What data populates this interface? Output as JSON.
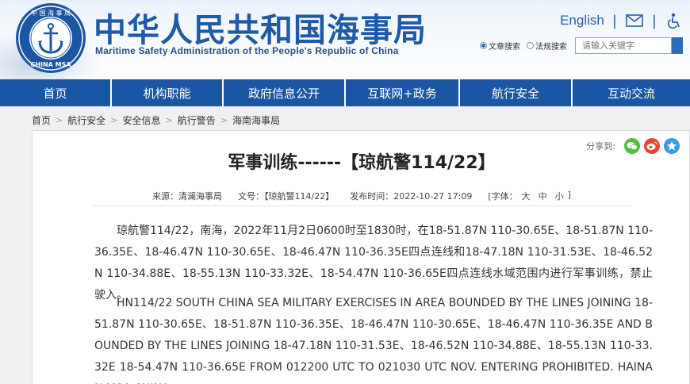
{
  "header": {
    "logo": {
      "top_text": "中 国 海 事 局",
      "bottom_text": "CHINA MSA"
    },
    "title": "中华人民共和国海事局",
    "subtitle": "Maritime Safety Administration of the People's Republic of China",
    "english_link": "English",
    "separator": "|",
    "search": {
      "option1": "文章搜索",
      "option2": "法规搜索",
      "placeholder": "请输入关键字"
    }
  },
  "nav": {
    "items": [
      {
        "label": "首页"
      },
      {
        "label": "机构职能"
      },
      {
        "label": "政府信息公开"
      },
      {
        "label": "互联网+政务"
      },
      {
        "label": "航行安全"
      },
      {
        "label": "互动交流"
      }
    ]
  },
  "breadcrumb": {
    "items": [
      "首页",
      "航行安全",
      "安全信息",
      "航行警告",
      "海南海事局"
    ],
    "separator": ">"
  },
  "article": {
    "share_label": "分享到:",
    "title": "军事训练------【琼航警114/22】",
    "meta": {
      "source": "来源：清澜海事局",
      "doc_no": "文号：【琼航警114/22】",
      "published": "发布时间：2022-10-27 17:09",
      "font_label": "[字体：",
      "font_large": "大",
      "font_medium": "中",
      "font_small": "小",
      "font_close": "]"
    },
    "paragraph_cn": "琼航警114/22，南海，2022年11月2日0600时至1830时，在18-51.87N 110-30.65E、18-51.87N 110-36.35E、18-46.47N 110-30.65E、18-46.47N 110-36.35E四点连线和18-47.18N 110-31.53E、18-46.52N 110-34.88E、18-55.13N 110-33.32E、18-54.47N 110-36.65E四点连线水域范围内进行军事训练，禁止驶入。",
    "paragraph_en": "HN114/22 SOUTH CHINA SEA MILITARY EXERCISES IN AREA BOUNDED BY THE LINES JOINING 18-51.87N 110-30.65E、18-51.87N 110-36.35E、18-46.47N 110-30.65E、18-46.47N 110-36.35E AND BOUNDED BY THE LINES JOINING 18-47.18N 110-31.53E、18-46.52N 110-34.88E、18-55.13N 110-33.32E 18-54.47N 110-36.65E FROM 012200 UTC TO 021030 UTC NOV. ENTERING PROHIBITED. HAINAN MSA CHINA."
  },
  "colors": {
    "brand_blue": "#1a56a3",
    "title_blue": "#1d5aa8",
    "wechat_green": "#4fbf40",
    "weibo_red": "#e5463a",
    "qzone_blue": "#3d9be0"
  }
}
